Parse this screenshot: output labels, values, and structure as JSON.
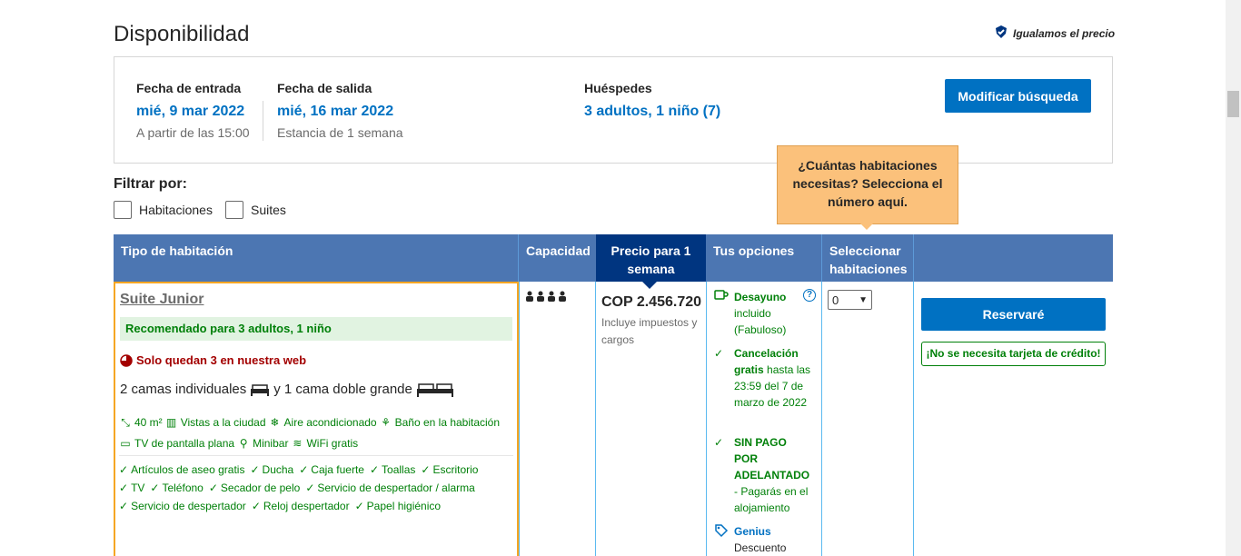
{
  "header": {
    "title": "Disponibilidad",
    "price_match": "Igualamos el precio"
  },
  "search": {
    "checkin_label": "Fecha de entrada",
    "checkin_value": "mié, 9 mar 2022",
    "checkin_sub": "A partir de las 15:00",
    "checkout_label": "Fecha de salida",
    "checkout_value": "mié, 16 mar 2022",
    "checkout_sub": "Estancia de 1 semana",
    "guests_label": "Huéspedes",
    "guests_value": "3 adultos, 1 niño (7)",
    "modify_button": "Modificar búsqueda"
  },
  "filter": {
    "title": "Filtrar por:",
    "options": [
      "Habitaciones",
      "Suites"
    ]
  },
  "tooltip": {
    "text_line1": "¿Cuántas habitaciones",
    "text_line2": "necesitas? Selecciona el",
    "text_line3": "número aquí."
  },
  "table": {
    "headers": {
      "room_type": "Tipo de habitación",
      "capacity": "Capacidad",
      "price_line1": "Precio para 1",
      "price_line2": "semana",
      "options": "Tus opciones",
      "select_line1": "Seleccionar",
      "select_line2": "habitaciones"
    },
    "room": {
      "name": "Suite Junior",
      "recommended": "Recomendado para 3 adultos, 1 niño",
      "only_left": "Solo quedan 3 en nuestra web",
      "beds_part1": "2 camas individuales",
      "beds_part2": "y 1 cama doble grande",
      "amenities_row1": [
        "40 m²",
        "Vistas a la ciudad",
        "Aire acondicionado",
        "Baño en la habitación"
      ],
      "amenities_row2": [
        "TV de pantalla plana",
        "Minibar",
        "WiFi gratis"
      ],
      "facilities_row1": [
        "Artículos de aseo gratis",
        "Ducha",
        "Caja fuerte",
        "Toallas",
        "Escritorio"
      ],
      "facilities_row2": [
        "TV",
        "Teléfono",
        "Secador de pelo",
        "Servicio de despertador / alarma"
      ],
      "facilities_row3": [
        "Servicio de despertador",
        "Reloj despertador",
        "Papel higiénico"
      ]
    },
    "price": {
      "amount": "COP 2.456.720",
      "note": "Incluye impuestos y cargos"
    },
    "options": {
      "breakfast_title": "Desayuno",
      "breakfast_sub1": "incluido",
      "breakfast_sub2": "(Fabuloso)",
      "cancel_title1": "Cancelación",
      "cancel_title2": "gratis",
      "cancel_sub": "hasta las 23:59 del 7 de marzo de 2022",
      "nopay_1": "SIN PAGO",
      "nopay_2": "POR",
      "nopay_3": "ADELANTADO",
      "nopay_sub": "- Pagarás en el alojamiento",
      "genius_title": "Genius",
      "genius_sub": "Descuento"
    },
    "select_value": "0",
    "reserve_button": "Reservaré",
    "no_card": "¡No se necesita tarjeta de crédito!"
  },
  "colors": {
    "primary_blue": "#0071c2",
    "header_blue": "#4c76b2",
    "dark_blue": "#003580",
    "green": "#008009",
    "tooltip_orange": "#fbc17b",
    "red": "#a30000"
  }
}
